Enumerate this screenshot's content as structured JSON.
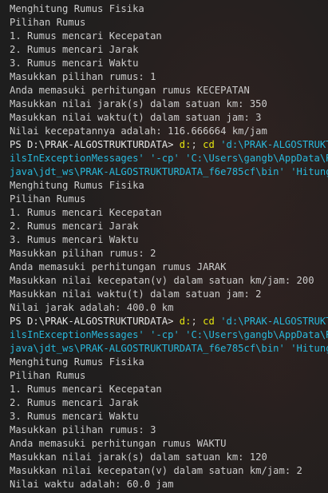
{
  "terminal": {
    "blocks": [
      {
        "output": [
          "Menghitung Rumus Fisika",
          "Pilihan Rumus",
          "1. Rumus mencari Kecepatan",
          "2. Rumus mencari Jarak",
          "3. Rumus mencari Waktu",
          "Masukkan pilihan rumus: 1",
          "Anda memasuki perhitungan rumus KECEPATAN",
          "Masukkan nilai jarak(s) dalam satuan km: 350",
          "Masukkan nilai waktu(t) dalam satuan jam: 3",
          "Nilai kecepatannya adalah: 116.666664 km/jam"
        ],
        "prompt": "PS D:\\PRAK-ALGOSTRUKTURDATA> ",
        "cmd_start": "d:",
        "cmd_sep": "; ",
        "cmd_cd": "cd",
        "cmd_path_start": " 'd:\\PRAK-ALGOSTRUKTU",
        "wrap1": "ilsInExceptionMessages' '-cp' 'C:\\Users\\gangb\\AppData\\Roa",
        "wrap2": "java\\jdt_ws\\PRAK-ALGOSTRUKTURDATA_f6e785cf\\bin' 'HitungRu"
      },
      {
        "output": [
          "Menghitung Rumus Fisika",
          "Pilihan Rumus",
          "1. Rumus mencari Kecepatan",
          "2. Rumus mencari Jarak",
          "3. Rumus mencari Waktu",
          "Masukkan pilihan rumus: 2",
          "Anda memasuki perhitungan rumus JARAK",
          "Masukkan nilai kecepatan(v) dalam satuan km/jam: 200",
          "Masukkan nilai waktu(t) dalam satuan jam: 2",
          "Nilai jarak adalah: 400.0 km"
        ],
        "prompt": "PS D:\\PRAK-ALGOSTRUKTURDATA> ",
        "cmd_start": "d:",
        "cmd_sep": "; ",
        "cmd_cd": "cd",
        "cmd_path_start": " 'd:\\PRAK-ALGOSTRUKTU",
        "wrap1": "ilsInExceptionMessages' '-cp' 'C:\\Users\\gangb\\AppData\\Roa",
        "wrap2": "java\\jdt_ws\\PRAK-ALGOSTRUKTURDATA_f6e785cf\\bin' 'HitungRu"
      },
      {
        "output": [
          "Menghitung Rumus Fisika",
          "Pilihan Rumus",
          "1. Rumus mencari Kecepatan",
          "2. Rumus mencari Jarak",
          "3. Rumus mencari Waktu",
          "Masukkan pilihan rumus: 3",
          "Anda memasuki perhitungan rumus WAKTU",
          "Masukkan nilai jarak(s) dalam satuan km: 120",
          "Masukkan nilai kecepatan(v) dalam satuan km/jam: 2",
          "Nilai waktu adalah: 60.0 jam"
        ]
      }
    ]
  },
  "colors": {
    "background": "#1e1e1e",
    "text": "#cccccc",
    "command": "#e5e510",
    "path": "#3b8eea",
    "argument": "#29b8db"
  }
}
